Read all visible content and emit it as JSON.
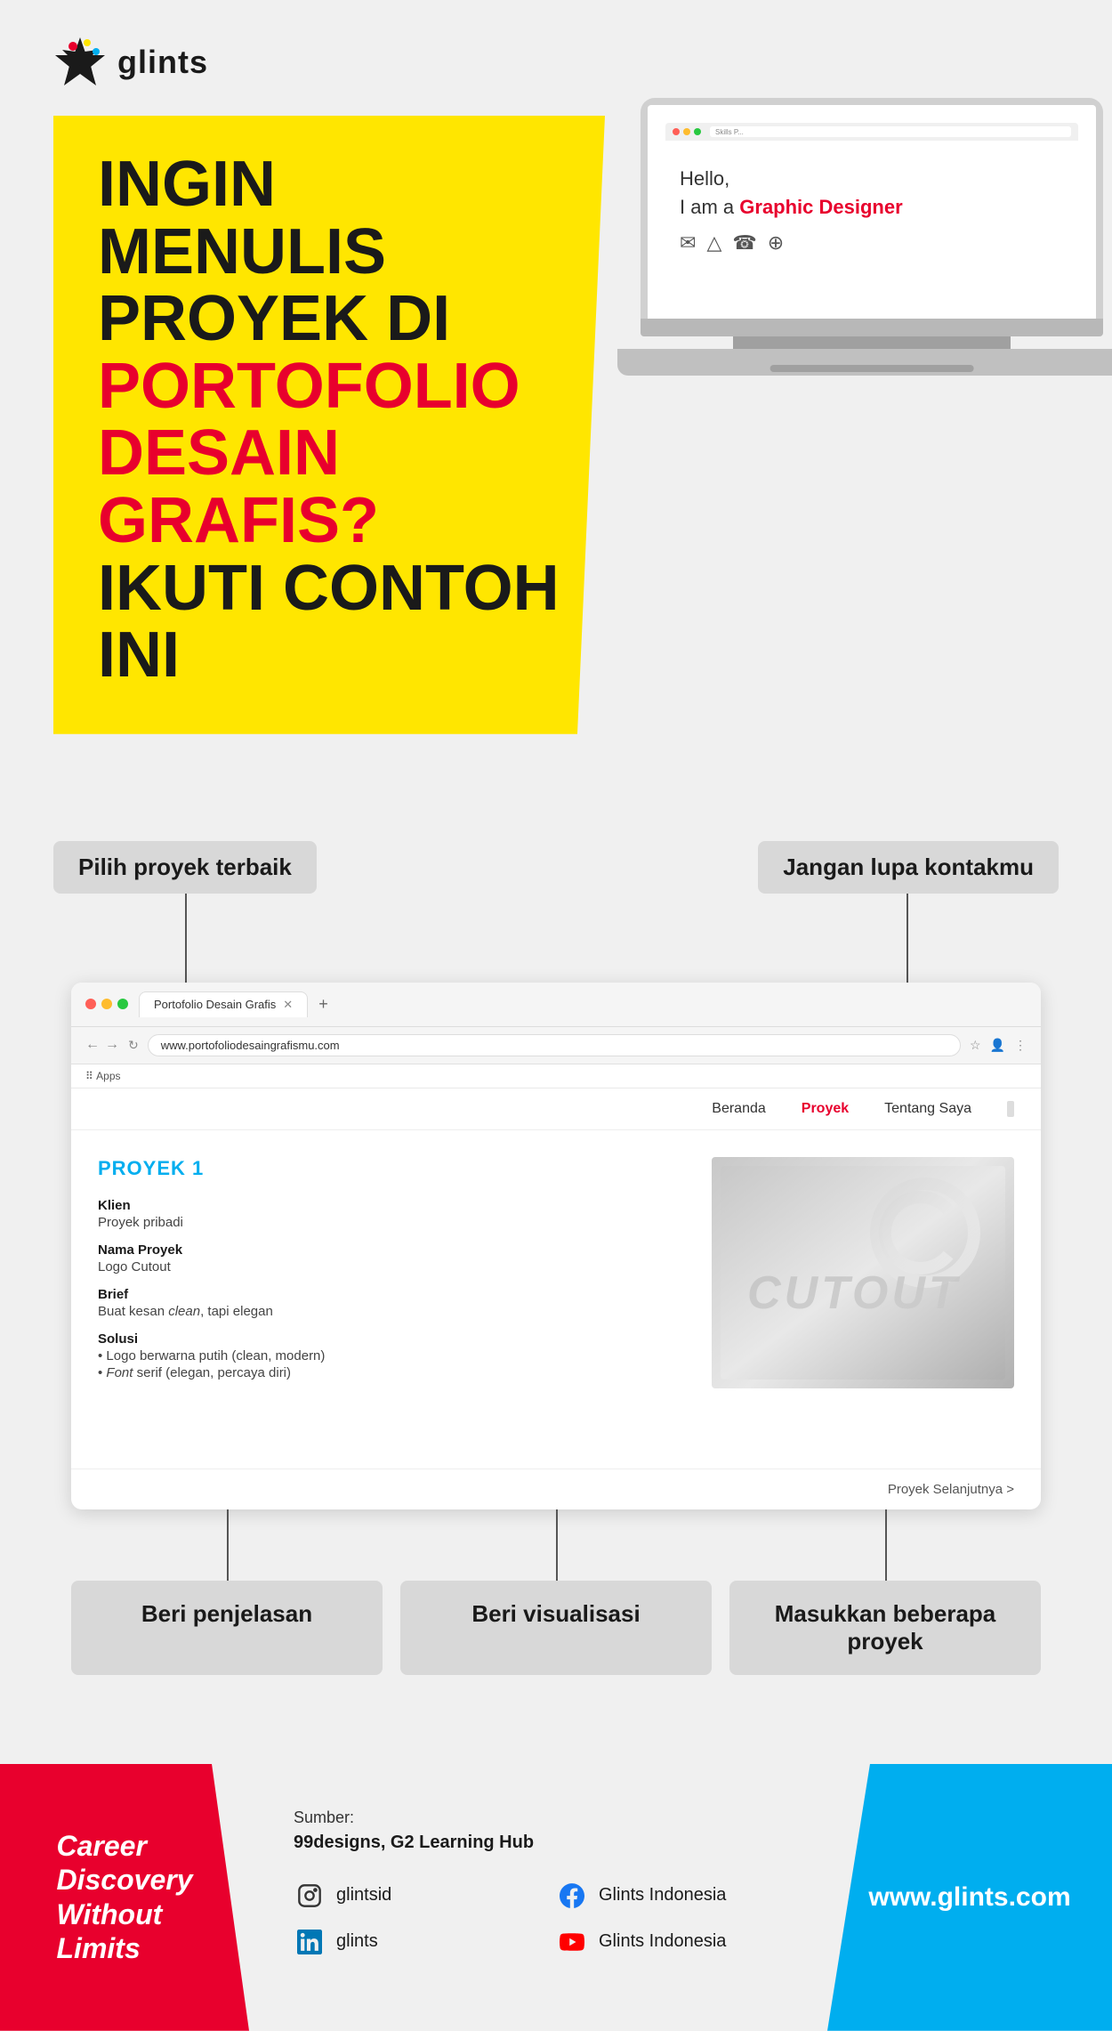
{
  "brand": {
    "name": "glints",
    "logo_alt": "Glints star logo"
  },
  "hero": {
    "headline_line1": "INGIN MENULIS",
    "headline_line2_black": "PROYEK DI",
    "headline_line2_red": "PORTOFOLIO",
    "headline_line3_red": "DESAIN GRAFIS?",
    "headline_line4": "IKUTI CONTOH INI"
  },
  "browser_mockup": {
    "tab_title": "Portofolio Desain Grafis",
    "url": "www.portofoliodesaingrafismu.com",
    "bookmarks_label": "Apps",
    "nav_items": [
      {
        "label": "Beranda",
        "active": false
      },
      {
        "label": "Proyek",
        "active": true
      },
      {
        "label": "Tentang Saya",
        "active": false
      }
    ],
    "project": {
      "title": "PROYEK 1",
      "fields": [
        {
          "label": "Klien",
          "value": "Proyek pribadi"
        },
        {
          "label": "Nama Proyek",
          "value": "Logo Cutout"
        },
        {
          "label": "Brief",
          "value": "Buat kesan clean, tapi elegan"
        },
        {
          "label": "Solusi",
          "value1": "• Logo berwarna putih (clean, modern)",
          "value2": "• Font serif (elegan, percaya diri)"
        }
      ],
      "next_link": "Proyek Selanjutnya >"
    }
  },
  "laptop_mockup": {
    "greeting": "Hello,",
    "role_prefix": "I am a",
    "role": "Graphic Designer"
  },
  "annotations": {
    "top_left": "Pilih proyek terbaik",
    "top_right": "Jangan lupa kontakmu",
    "bottom_left": "Beri penjelasan",
    "bottom_middle": "Beri visualisasi",
    "bottom_right": "Masukkan beberapa\nproyek"
  },
  "footer": {
    "tagline": "Career Discovery Without Limits",
    "source_label": "Sumber:",
    "source_names": "99designs, G2 Learning Hub",
    "social_items": [
      {
        "platform": "instagram",
        "handle": "glintsid",
        "icon": "📷"
      },
      {
        "platform": "facebook",
        "name": "Glints Indonesia",
        "icon": "f"
      },
      {
        "platform": "linkedin",
        "handle": "glints",
        "icon": "in"
      },
      {
        "platform": "youtube",
        "name": "Glints Indonesia",
        "icon": "▶"
      }
    ],
    "website": "www.glints.com"
  }
}
